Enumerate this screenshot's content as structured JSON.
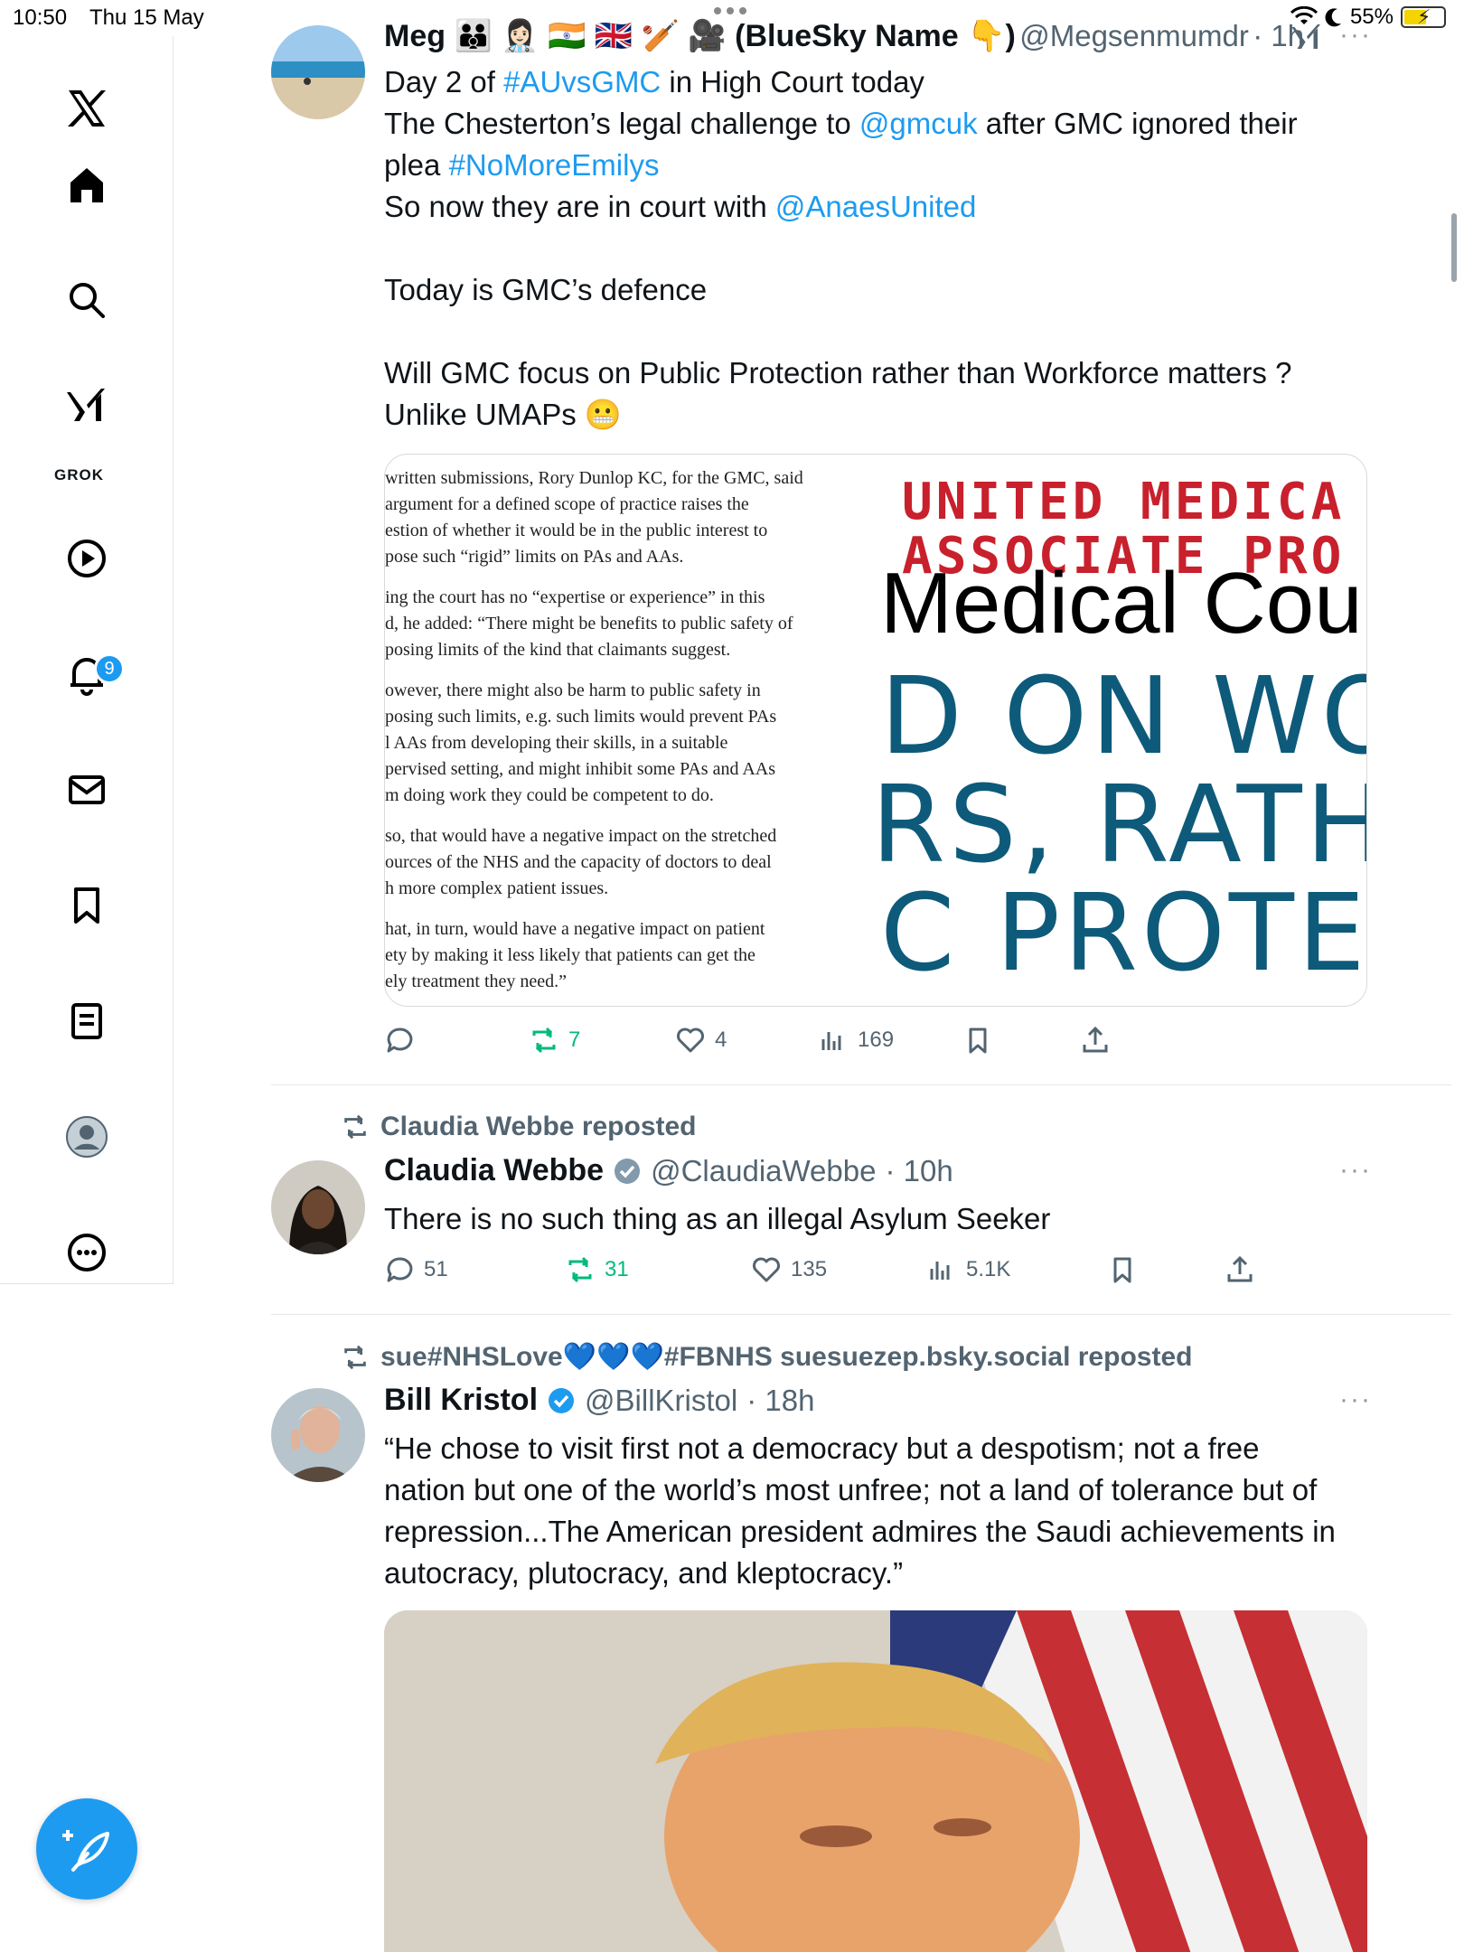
{
  "status_bar": {
    "time": "10:50",
    "date": "Thu 15 May",
    "battery": "55%"
  },
  "sidebar": {
    "grok_label": "GROK",
    "notifications_badge": "9"
  },
  "posts": [
    {
      "repost_by": "",
      "author": "Meg 🧑‍🧑‍🧒 👩🏻‍⚕️ 🇮🇳 🇬🇧 🏏 🎥 (BlueSky Name 👇)",
      "handle": "@Megsenmumdr",
      "time": "· 1h",
      "lines": [
        {
          "pre": "Day 2 of ",
          "link": "#AUvsGMC",
          "post": " in High Court today"
        },
        {
          "pre": "The Chesterton’s legal challenge to ",
          "link": "@gmcuk",
          "post": " after GMC ignored their"
        },
        {
          "pre": "plea ",
          "link": "#NoMoreEmilys",
          "post": ""
        },
        {
          "pre": "So now they are in court with ",
          "link": "@AnaesUnited",
          "post": ""
        }
      ],
      "para2": "Today is GMC’s defence",
      "para3_line1": "Will GMC focus on Public Protection rather than Workforce matters ?",
      "para3_line2": "Unlike UMAPs 😬",
      "media_left": [
        "written submissions, Rory Dunlop KC, for the GMC, said",
        " argument for a defined scope of practice raises the",
        "estion of whether it would be in the public interest to",
        "pose such “rigid” limits on PAs and AAs.",
        "ing the court has no “expertise or experience” in this",
        "d, he added: “There might be benefits to public safety of",
        "posing limits of the kind that claimants suggest.",
        "owever, there might also be harm to public safety in",
        "posing such limits, e.g. such limits would prevent PAs",
        "l AAs from developing their skills, in a suitable",
        "pervised setting, and might inhibit some PAs and AAs",
        "m doing work they could be competent to do.",
        "so, that would have a negative impact on the stretched",
        "ources of the NHS and the capacity of doctors to deal",
        "h more complex patient issues.",
        "hat, in turn, would have a negative impact on patient",
        "ety by making it less likely that patients can get the",
        "ely treatment they need.”"
      ],
      "media_right": {
        "line1": "UNITED MEDICA",
        "line2": "ASSOCIATE PRO",
        "line3": "Medical Cou",
        "line4": "D ON WO",
        "line5": "RS, RATHE",
        "line6": "C PROTEC"
      },
      "stats": {
        "replies": "",
        "reposts": "7",
        "likes": "4",
        "views": "169"
      }
    },
    {
      "repost_by": "Claudia Webbe reposted",
      "author": "Claudia Webbe",
      "handle": "@ClaudiaWebbe",
      "time": "· 10h",
      "text": "There is no such thing as an illegal Asylum Seeker",
      "stats": {
        "replies": "51",
        "reposts": "31",
        "likes": "135",
        "views": "5.1K"
      }
    },
    {
      "repost_by": "sue#NHSLove💙💙💙#FBNHS suesuezep.bsky.social reposted",
      "author": "Bill Kristol",
      "handle": "@BillKristol",
      "time": "· 18h",
      "lines": [
        "“He chose to visit first not a democracy but a despotism; not a free",
        "nation but one of the world’s most unfree; not a land of tolerance but of",
        "repression...The American president admires the Saudi achievements in",
        "autocracy, plutocracy, and kleptocracy.”"
      ]
    }
  ],
  "colors": {
    "accent": "#1d9bf0",
    "repost_green": "#00ba7c",
    "secondary_text": "#536471"
  }
}
